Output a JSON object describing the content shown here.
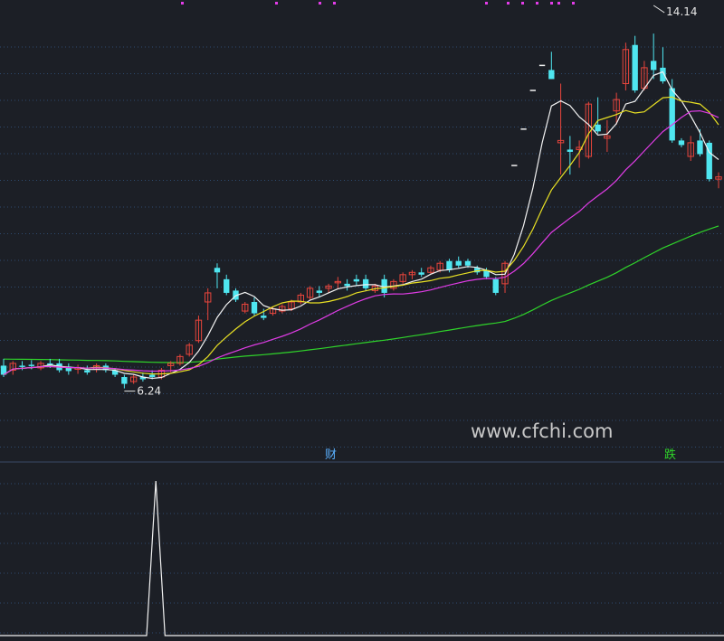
{
  "watermark": "www.cfchi.com",
  "colors": {
    "background": "#1c1f26",
    "grid": "#2e4a6e",
    "up": "#e8453c",
    "down": "#4fe6f0",
    "ma5": "#f2f2f2",
    "ma10": "#e8e024",
    "ma20": "#e03ce6",
    "ma60": "#2fd42a",
    "marker": "#e23ce8",
    "indicator": "#f2f2f2"
  },
  "chart_data": [
    {
      "type": "candlestick",
      "title": "",
      "y_range": [
        5.0,
        14.6
      ],
      "grid": true,
      "candles": [
        {
          "o": 6.8,
          "h": 6.95,
          "l": 6.55,
          "c": 6.6
        },
        {
          "o": 6.7,
          "h": 6.9,
          "l": 6.6,
          "c": 6.85
        },
        {
          "o": 6.8,
          "h": 6.9,
          "l": 6.7,
          "c": 6.78
        },
        {
          "o": 6.82,
          "h": 6.92,
          "l": 6.72,
          "c": 6.8
        },
        {
          "o": 6.75,
          "h": 6.9,
          "l": 6.7,
          "c": 6.85
        },
        {
          "o": 6.85,
          "h": 6.95,
          "l": 6.75,
          "c": 6.8
        },
        {
          "o": 6.85,
          "h": 6.95,
          "l": 6.65,
          "c": 6.7
        },
        {
          "o": 6.78,
          "h": 6.85,
          "l": 6.6,
          "c": 6.68
        },
        {
          "o": 6.72,
          "h": 6.82,
          "l": 6.62,
          "c": 6.75
        },
        {
          "o": 6.7,
          "h": 6.8,
          "l": 6.6,
          "c": 6.65
        },
        {
          "o": 6.72,
          "h": 6.85,
          "l": 6.65,
          "c": 6.8
        },
        {
          "o": 6.8,
          "h": 6.85,
          "l": 6.65,
          "c": 6.7
        },
        {
          "o": 6.7,
          "h": 6.75,
          "l": 6.55,
          "c": 6.6
        },
        {
          "o": 6.55,
          "h": 6.6,
          "l": 6.3,
          "c": 6.4
        },
        {
          "o": 6.45,
          "h": 6.6,
          "l": 6.4,
          "c": 6.55
        },
        {
          "o": 6.55,
          "h": 6.65,
          "l": 6.45,
          "c": 6.5
        },
        {
          "o": 6.6,
          "h": 6.7,
          "l": 6.5,
          "c": 6.55
        },
        {
          "o": 6.55,
          "h": 6.75,
          "l": 6.5,
          "c": 6.7
        },
        {
          "o": 6.8,
          "h": 6.9,
          "l": 6.65,
          "c": 6.85
        },
        {
          "o": 6.85,
          "h": 7.05,
          "l": 6.8,
          "c": 7.0
        },
        {
          "o": 7.05,
          "h": 7.3,
          "l": 7.0,
          "c": 7.25
        },
        {
          "o": 7.35,
          "h": 7.9,
          "l": 7.3,
          "c": 7.8
        },
        {
          "o": 8.2,
          "h": 8.5,
          "l": 7.8,
          "c": 8.4
        },
        {
          "o": 8.95,
          "h": 9.05,
          "l": 8.5,
          "c": 8.85
        },
        {
          "o": 8.7,
          "h": 8.8,
          "l": 8.35,
          "c": 8.4
        },
        {
          "o": 8.45,
          "h": 8.5,
          "l": 8.2,
          "c": 8.25
        },
        {
          "o": 8.0,
          "h": 8.2,
          "l": 7.95,
          "c": 8.15
        },
        {
          "o": 8.2,
          "h": 8.3,
          "l": 7.9,
          "c": 7.95
        },
        {
          "o": 7.9,
          "h": 8.05,
          "l": 7.8,
          "c": 7.85
        },
        {
          "o": 7.95,
          "h": 8.1,
          "l": 7.9,
          "c": 8.05
        },
        {
          "o": 8.0,
          "h": 8.15,
          "l": 7.95,
          "c": 8.1
        },
        {
          "o": 8.05,
          "h": 8.25,
          "l": 8.0,
          "c": 8.2
        },
        {
          "o": 8.2,
          "h": 8.4,
          "l": 8.15,
          "c": 8.35
        },
        {
          "o": 8.3,
          "h": 8.55,
          "l": 8.25,
          "c": 8.5
        },
        {
          "o": 8.45,
          "h": 8.55,
          "l": 8.3,
          "c": 8.4
        },
        {
          "o": 8.5,
          "h": 8.6,
          "l": 8.4,
          "c": 8.55
        },
        {
          "o": 8.65,
          "h": 8.75,
          "l": 8.5,
          "c": 8.65
        },
        {
          "o": 8.6,
          "h": 8.7,
          "l": 8.45,
          "c": 8.55
        },
        {
          "o": 8.7,
          "h": 8.8,
          "l": 8.55,
          "c": 8.65
        },
        {
          "o": 8.7,
          "h": 8.8,
          "l": 8.45,
          "c": 8.5
        },
        {
          "o": 8.45,
          "h": 8.6,
          "l": 8.4,
          "c": 8.55
        },
        {
          "o": 8.7,
          "h": 8.8,
          "l": 8.3,
          "c": 8.4
        },
        {
          "o": 8.5,
          "h": 8.7,
          "l": 8.45,
          "c": 8.65
        },
        {
          "o": 8.65,
          "h": 8.85,
          "l": 8.6,
          "c": 8.8
        },
        {
          "o": 8.8,
          "h": 8.9,
          "l": 8.7,
          "c": 8.85
        },
        {
          "o": 8.85,
          "h": 8.95,
          "l": 8.75,
          "c": 8.8
        },
        {
          "o": 8.85,
          "h": 9.0,
          "l": 8.8,
          "c": 8.95
        },
        {
          "o": 8.9,
          "h": 9.1,
          "l": 8.85,
          "c": 9.05
        },
        {
          "o": 9.1,
          "h": 9.15,
          "l": 8.85,
          "c": 8.9
        },
        {
          "o": 9.1,
          "h": 9.2,
          "l": 8.95,
          "c": 9.0
        },
        {
          "o": 9.1,
          "h": 9.15,
          "l": 8.95,
          "c": 9.0
        },
        {
          "o": 8.95,
          "h": 9.0,
          "l": 8.8,
          "c": 8.85
        },
        {
          "o": 8.9,
          "h": 8.95,
          "l": 8.7,
          "c": 8.75
        },
        {
          "o": 8.7,
          "h": 8.75,
          "l": 8.35,
          "c": 8.4
        },
        {
          "o": 8.6,
          "h": 9.1,
          "l": 8.4,
          "c": 9.05
        },
        {
          "o": 11.2,
          "h": 11.2,
          "l": 11.2,
          "c": 11.2
        },
        {
          "o": 12.0,
          "h": 12.0,
          "l": 12.0,
          "c": 12.0
        },
        {
          "o": 12.85,
          "h": 12.85,
          "l": 12.85,
          "c": 12.85
        },
        {
          "o": 13.4,
          "h": 13.4,
          "l": 13.4,
          "c": 13.4
        },
        {
          "o": 13.3,
          "h": 13.7,
          "l": 13.1,
          "c": 13.1
        },
        {
          "o": 11.7,
          "h": 13.0,
          "l": 11.0,
          "c": 11.75
        },
        {
          "o": 11.55,
          "h": 11.85,
          "l": 11.0,
          "c": 11.5
        },
        {
          "o": 11.55,
          "h": 11.75,
          "l": 11.15,
          "c": 11.6
        },
        {
          "o": 11.4,
          "h": 12.6,
          "l": 11.35,
          "c": 12.55
        },
        {
          "o": 12.1,
          "h": 12.7,
          "l": 11.9,
          "c": 11.95
        },
        {
          "o": 11.8,
          "h": 12.2,
          "l": 11.5,
          "c": 11.85
        },
        {
          "o": 12.4,
          "h": 12.8,
          "l": 12.1,
          "c": 12.65
        },
        {
          "o": 13.0,
          "h": 13.9,
          "l": 12.85,
          "c": 13.75
        },
        {
          "o": 13.85,
          "h": 14.05,
          "l": 12.8,
          "c": 12.85
        },
        {
          "o": 12.9,
          "h": 13.5,
          "l": 12.85,
          "c": 13.35
        },
        {
          "o": 13.5,
          "h": 14.1,
          "l": 13.1,
          "c": 13.3
        },
        {
          "o": 13.35,
          "h": 13.8,
          "l": 13.0,
          "c": 13.05
        },
        {
          "o": 12.9,
          "h": 13.1,
          "l": 11.7,
          "c": 11.75
        },
        {
          "o": 11.75,
          "h": 11.8,
          "l": 11.6,
          "c": 11.65
        },
        {
          "o": 11.4,
          "h": 11.85,
          "l": 11.3,
          "c": 11.7
        },
        {
          "o": 11.75,
          "h": 12.0,
          "l": 11.4,
          "c": 11.45
        },
        {
          "o": 11.7,
          "h": 11.75,
          "l": 10.85,
          "c": 10.9
        },
        {
          "o": 10.9,
          "h": 11.05,
          "l": 10.7,
          "c": 10.95
        }
      ],
      "moving_averages": [
        {
          "period": 5
        },
        {
          "period": 10
        },
        {
          "period": 20
        },
        {
          "period": 60,
          "start_value": 6.95
        }
      ],
      "annotations": [
        {
          "text": "14.14",
          "value": 14.14
        },
        {
          "text": "6.24",
          "value": 6.24
        }
      ],
      "signals": [
        {
          "text": "财"
        },
        {
          "text": "跌"
        }
      ]
    },
    {
      "type": "line",
      "title": "",
      "values": [
        0,
        0,
        0,
        0,
        0,
        0,
        0,
        0,
        0,
        0,
        0,
        0,
        0,
        0,
        0,
        0,
        0,
        0,
        0,
        0,
        0,
        0,
        0,
        0,
        0,
        0,
        0,
        0,
        0,
        0,
        0,
        0,
        0,
        0,
        0,
        0,
        0,
        0,
        0,
        0,
        0,
        0,
        0,
        0,
        0,
        0,
        0,
        0,
        0,
        0,
        0,
        0,
        0,
        0,
        0,
        0,
        0,
        0,
        0,
        0,
        0,
        0,
        0,
        0,
        0,
        0,
        0,
        0,
        0,
        0,
        0,
        0,
        0,
        0,
        0,
        0,
        0,
        0,
        0,
        0
      ],
      "spike": {
        "index": 17,
        "value": 1
      }
    }
  ]
}
